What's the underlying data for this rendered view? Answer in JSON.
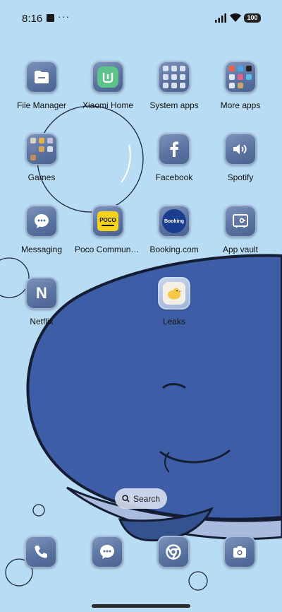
{
  "status": {
    "time": "8:16",
    "more": "···",
    "battery": "100"
  },
  "apps": [
    {
      "label": "File Manager",
      "icon": "file-manager-icon"
    },
    {
      "label": "Xiaomi Home",
      "icon": "xiaomi-home-icon"
    },
    {
      "label": "System apps",
      "icon": "system-apps-folder-icon"
    },
    {
      "label": "More apps",
      "icon": "more-apps-folder-icon"
    },
    {
      "label": "Games",
      "icon": "games-folder-icon"
    },
    {
      "label": "Facebook",
      "icon": "facebook-icon"
    },
    {
      "label": "Spotify",
      "icon": "spotify-icon"
    },
    {
      "label": "Messaging",
      "icon": "messaging-icon"
    },
    {
      "label": "Poco Communi…",
      "icon": "poco-community-icon",
      "icon_text": "POCO"
    },
    {
      "label": "Booking.com",
      "icon": "booking-icon",
      "icon_text": "Booking"
    },
    {
      "label": "App vault",
      "icon": "app-vault-icon"
    },
    {
      "label": "Netflix",
      "icon": "netflix-icon",
      "icon_text": "N"
    },
    {
      "label": "Leaks",
      "icon": "leaks-icon"
    }
  ],
  "search": {
    "label": "Search"
  },
  "dock": [
    {
      "icon": "phone-icon"
    },
    {
      "icon": "messages-icon"
    },
    {
      "icon": "chrome-icon"
    },
    {
      "icon": "camera-icon"
    }
  ],
  "colors": {
    "wallpaper": "#b7dcf3",
    "whale": "#3d5ea6",
    "tile": "#5a73a0"
  }
}
